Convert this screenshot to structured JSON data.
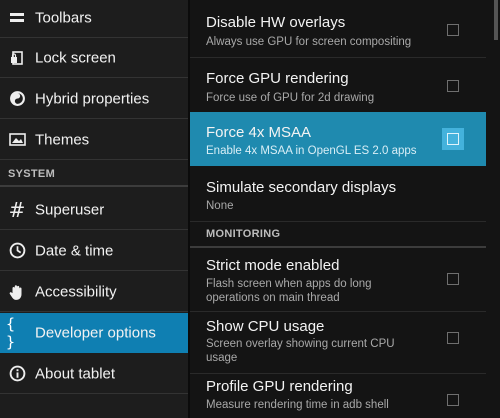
{
  "sidebar": {
    "items_top": [
      {
        "label": "Toolbars",
        "icon": "toolbars-icon"
      },
      {
        "label": "Lock screen",
        "icon": "lock-screen-icon"
      },
      {
        "label": "Hybrid properties",
        "icon": "hybrid-icon"
      },
      {
        "label": "Themes",
        "icon": "themes-icon"
      }
    ],
    "section_label": "SYSTEM",
    "items_system": [
      {
        "label": "Superuser",
        "icon": "hash-icon"
      },
      {
        "label": "Date & time",
        "icon": "clock-icon"
      },
      {
        "label": "Accessibility",
        "icon": "hand-icon"
      },
      {
        "label": "Developer options",
        "icon": "braces-icon",
        "selected": true
      },
      {
        "label": "About tablet",
        "icon": "info-icon"
      }
    ]
  },
  "prefs": [
    {
      "title": "Disable HW overlays",
      "summary": "Always use GPU for screen compositing",
      "checked": false
    },
    {
      "title": "Force GPU rendering",
      "summary": "Force use of GPU for 2d drawing",
      "checked": false
    },
    {
      "title": "Force 4x MSAA",
      "summary": "Enable 4x MSAA in OpenGL ES 2.0 apps",
      "checked": false,
      "highlighted": true
    },
    {
      "title": "Simulate secondary displays",
      "summary": "None"
    }
  ],
  "monitoring_header": "MONITORING",
  "monitoring": [
    {
      "title": "Strict mode enabled",
      "summary": "Flash screen when apps do long operations on main thread",
      "checked": false
    },
    {
      "title": "Show CPU usage",
      "summary": "Screen overlay showing current CPU usage",
      "checked": false
    },
    {
      "title": "Profile GPU rendering",
      "summary": "Measure rendering time in adb shell",
      "checked": false
    }
  ],
  "colors": {
    "accent": "#0f7fb2",
    "highlight": "#1f8aaf",
    "checkbox_highlight": "#44b2dc"
  }
}
